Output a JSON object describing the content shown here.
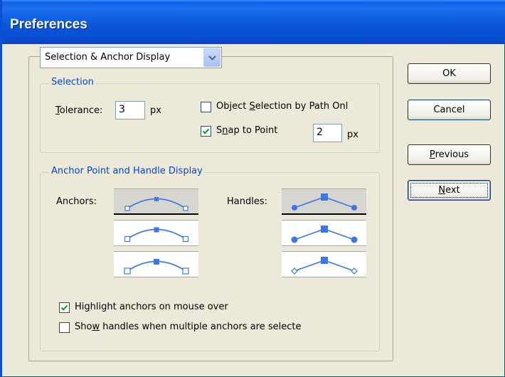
{
  "window": {
    "title": "Preferences"
  },
  "pane_selector": {
    "value": "Selection & Anchor Display",
    "icon": "chevron-down-icon"
  },
  "selection_group": {
    "legend": "Selection",
    "tolerance": {
      "label_pre": "",
      "label_ul": "T",
      "label_post": "olerance:",
      "value": "3",
      "unit": "px"
    },
    "object_selection": {
      "pre": "Object ",
      "ul": "S",
      "post": "election by Path Onl",
      "checked": false
    },
    "snap_to_point": {
      "pre": "S",
      "ul": "n",
      "post": "ap to Point",
      "checked": true,
      "value": "2",
      "unit": "px"
    }
  },
  "anchor_group": {
    "legend": "Anchor Point and Handle Display",
    "anchors_label": "Anchors:",
    "handles_label": "Handles:",
    "anchor_styles_selected": 0,
    "handle_styles_selected": 0,
    "highlight": {
      "pre": "Hi",
      "ul": "g",
      "post": "hlight anchors on mouse over",
      "checked": true
    },
    "show_handles": {
      "pre": "Sho",
      "ul": "w",
      "post": " handles when multiple anchors are selecte",
      "checked": false
    }
  },
  "buttons": {
    "ok": "OK",
    "cancel": "Cancel",
    "previous": {
      "ul": "P",
      "post": "revious"
    },
    "next": {
      "ul": "N",
      "post": "ext"
    }
  },
  "colors": {
    "accent": "#0046d5",
    "titlebar": "#0b58de",
    "curve": "#3b78e7"
  }
}
